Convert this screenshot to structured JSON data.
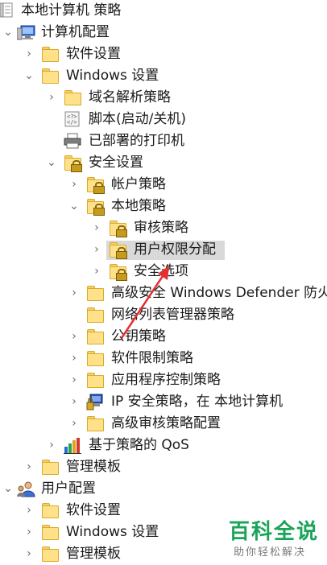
{
  "tree": {
    "root": {
      "label": "本地计算机 策略",
      "icon": "policy-document-icon"
    },
    "computer_config": {
      "label": "计算机配置",
      "icon": "computer-icon"
    },
    "cc_software": {
      "label": "软件设置"
    },
    "cc_windows": {
      "label": "Windows 设置"
    },
    "dns": {
      "label": "域名解析策略"
    },
    "scripts": {
      "label": "脚本(启动/关机)",
      "icon": "script-icon"
    },
    "printers": {
      "label": "已部署的打印机",
      "icon": "printer-icon"
    },
    "security": {
      "label": "安全设置"
    },
    "account": {
      "label": "帐户策略"
    },
    "local": {
      "label": "本地策略"
    },
    "audit": {
      "label": "审核策略"
    },
    "rights": {
      "label": "用户权限分配",
      "selected": true
    },
    "secopts": {
      "label": "安全选项"
    },
    "defender": {
      "label": "高级安全 Windows Defender 防火"
    },
    "netlist": {
      "label": "网络列表管理器策略"
    },
    "pubkey": {
      "label": "公钥策略"
    },
    "srp": {
      "label": "软件限制策略"
    },
    "applocker": {
      "label": "应用程序控制策略"
    },
    "ipsec": {
      "label": "IP 安全策略，在 本地计算机",
      "icon": "ipsec-icon"
    },
    "advaudit": {
      "label": "高级审核策略配置"
    },
    "qos": {
      "label": "基于策略的 QoS",
      "icon": "bar-chart-icon"
    },
    "cc_admin": {
      "label": "管理模板"
    },
    "user_config": {
      "label": "用户配置",
      "icon": "user-icon"
    },
    "uc_software": {
      "label": "软件设置"
    },
    "uc_windows": {
      "label": "Windows 设置"
    },
    "uc_admin": {
      "label": "管理模板"
    }
  },
  "watermark": {
    "main": "百科全说",
    "sub": "助你轻松解决"
  },
  "colors": {
    "selection": "#d9d9d9",
    "folder": "#ffe18a",
    "arrow": "#e33030",
    "watermark": "#1aa35a"
  }
}
